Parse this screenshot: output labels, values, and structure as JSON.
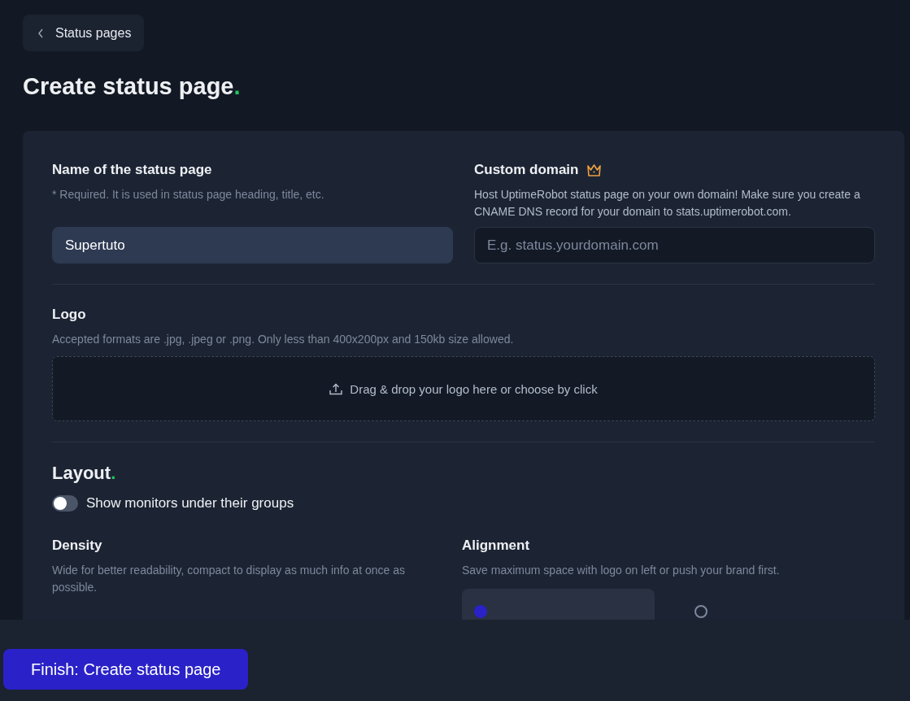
{
  "back_link": {
    "label": "Status pages"
  },
  "title": {
    "text": "Create status page",
    "dot": "."
  },
  "name_field": {
    "label": "Name of the status page",
    "hint": "* Required. It is used in status page heading, title, etc.",
    "value": "Supertuto"
  },
  "domain_field": {
    "label": "Custom domain",
    "premium": true,
    "hint": "Host UptimeRobot status page on your own domain! Make sure you create a CNAME DNS record for your domain to stats.uptimerobot.com.",
    "placeholder": "E.g. status.yourdomain.com"
  },
  "logo": {
    "label": "Logo",
    "hint": "Accepted formats are .jpg, .jpeg or .png. Only less than 400x200px and 150kb size allowed.",
    "dropzone": "Drag & drop your logo here or choose by click"
  },
  "layout": {
    "heading": "Layout",
    "dot": ".",
    "toggle": {
      "label": "Show monitors under their groups",
      "on": false
    },
    "density": {
      "label": "Density",
      "hint": "Wide for better readability, compact to display as much info at once as possible."
    },
    "alignment": {
      "label": "Alignment",
      "hint": "Save maximum space with logo on left or push your brand first.",
      "options": [
        {
          "selected": true
        },
        {
          "selected": false
        }
      ]
    }
  },
  "footer": {
    "button": "Finish: Create status page"
  }
}
